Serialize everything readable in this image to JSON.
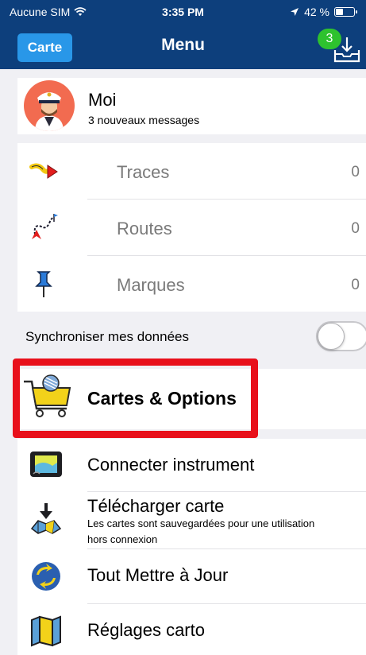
{
  "status": {
    "carrier": "Aucune SIM",
    "time": "3:35 PM",
    "battery": "42 %",
    "battery_level": 0.42
  },
  "nav": {
    "back_label": "Carte",
    "title": "Menu",
    "badge_count": "3"
  },
  "profile": {
    "name": "Moi",
    "subtitle": "3 nouveaux messages"
  },
  "tracks": [
    {
      "label": "Traces",
      "count": "0",
      "icon": "track-icon"
    },
    {
      "label": "Routes",
      "count": "0",
      "icon": "route-icon"
    },
    {
      "label": "Marques",
      "count": "0",
      "icon": "pin-icon"
    }
  ],
  "sync": {
    "label": "Synchroniser mes données",
    "enabled": false
  },
  "cartes": {
    "label": "Cartes & Options"
  },
  "menu": [
    {
      "label": "Connecter instrument",
      "icon": "instrument-icon"
    },
    {
      "label": "Télécharger carte",
      "sub": "Les cartes sont sauvegardées pour une utilisation hors connexion",
      "icon": "download-map-icon"
    },
    {
      "label": "Tout Mettre à Jour",
      "icon": "update-globe-icon"
    },
    {
      "label": "Réglages carto",
      "icon": "map-settings-icon"
    }
  ],
  "colors": {
    "nav": "#0d3f7c",
    "accent": "#2997e8",
    "badge": "#2ec22e",
    "highlight": "#e8101b"
  }
}
